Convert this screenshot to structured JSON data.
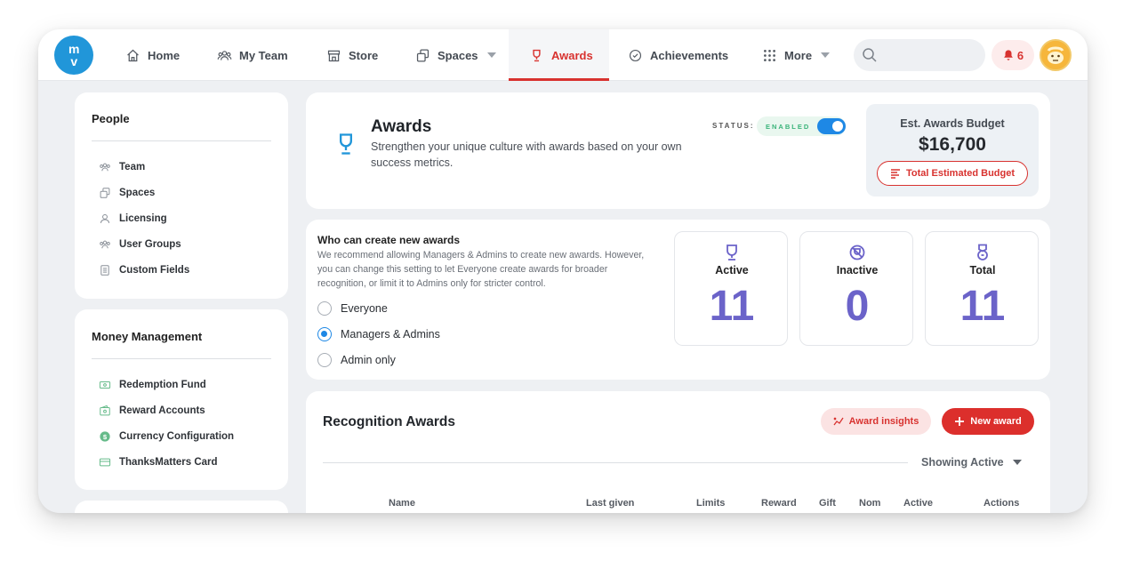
{
  "nav": {
    "items": [
      {
        "label": "Home"
      },
      {
        "label": "My Team"
      },
      {
        "label": "Store"
      },
      {
        "label": "Spaces"
      },
      {
        "label": "Awards"
      },
      {
        "label": "Achievements"
      },
      {
        "label": "More"
      }
    ],
    "notifications_count": "6",
    "search_placeholder": "",
    "accent_color": "#d8322f"
  },
  "sidebar": {
    "people": {
      "title": "People",
      "items": [
        {
          "label": "Team"
        },
        {
          "label": "Spaces"
        },
        {
          "label": "Licensing"
        },
        {
          "label": "User Groups"
        },
        {
          "label": "Custom Fields"
        }
      ]
    },
    "money": {
      "title": "Money Management",
      "items": [
        {
          "label": "Redemption Fund"
        },
        {
          "label": "Reward Accounts"
        },
        {
          "label": "Currency Configuration"
        },
        {
          "label": "ThanksMatters Card"
        }
      ]
    }
  },
  "awards_header": {
    "title": "Awards",
    "subtitle": "Strengthen your unique culture with awards based on your own success metrics.",
    "status_label": "STATUS:",
    "status_value": "ENABLED",
    "budget_label": "Est. Awards Budget",
    "budget_value": "$16,700",
    "budget_button": "Total Estimated Budget"
  },
  "permissions": {
    "title": "Who can create new awards",
    "description": "We recommend allowing Managers & Admins to create new awards. However, you can change this setting to let Everyone create awards for broader recognition, or limit it to Admins only for stricter control.",
    "options": [
      {
        "label": "Everyone",
        "checked": false
      },
      {
        "label": "Managers & Admins",
        "checked": true
      },
      {
        "label": "Admin only",
        "checked": false
      }
    ]
  },
  "stats": [
    {
      "label": "Active",
      "value": "11"
    },
    {
      "label": "Inactive",
      "value": "0"
    },
    {
      "label": "Total",
      "value": "11"
    }
  ],
  "recognition": {
    "title": "Recognition Awards",
    "insights_button": "Award insights",
    "new_button": "New award",
    "filter": "Showing Active",
    "columns": [
      "Name",
      "Last given",
      "Limits",
      "Reward",
      "Gift",
      "Nom",
      "Active",
      "Actions"
    ]
  }
}
